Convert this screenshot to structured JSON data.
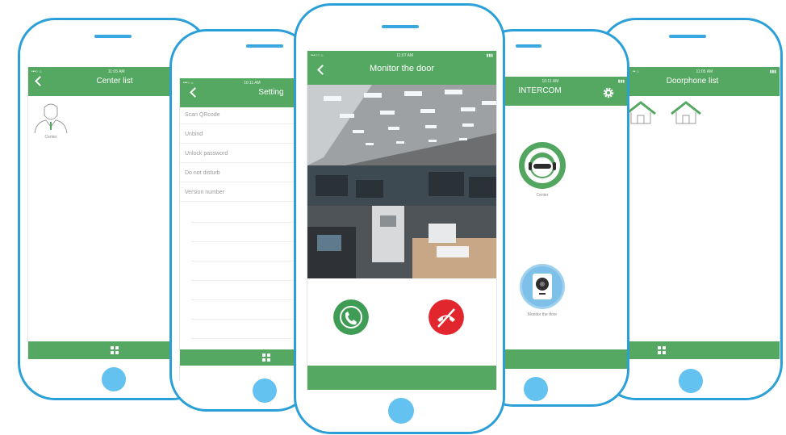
{
  "phone1": {
    "title": "Center list",
    "item_label": "Center"
  },
  "phone2": {
    "title": "Setting",
    "items": [
      "Scan QRcode",
      "Unbind",
      "Unlock password",
      "Do not disturb",
      "Version number"
    ]
  },
  "phone3": {
    "time": "11:07 AM",
    "title": "Monitor the door"
  },
  "phone4": {
    "title": "INTERCOM",
    "center_label": "Center",
    "monitor_label": "Monitor the door"
  },
  "phone5": {
    "title": "Doorphone list"
  },
  "colors": {
    "accent": "#55a862",
    "phone_frame": "#2a9fd8",
    "answer": "#3f9c55",
    "hangup": "#e2262e"
  },
  "icons": [
    "back-icon",
    "grid-icon",
    "gear-icon",
    "phone-answer-icon",
    "phone-hangup-icon",
    "person-icon",
    "house-icon",
    "camera-icon"
  ]
}
